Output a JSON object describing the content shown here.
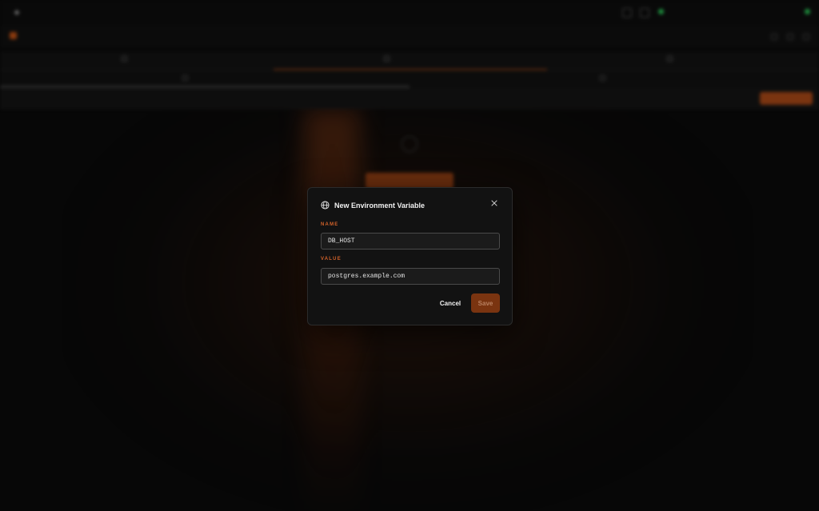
{
  "modal": {
    "title": "New Environment Variable",
    "name_label": "NAME",
    "name_value": "DB_HOST",
    "value_label": "VALUE",
    "value_value": "postgres.example.com",
    "cancel_label": "Cancel",
    "save_label": "Save",
    "title_icon": "globe-icon",
    "close_icon": "close-icon"
  },
  "colors": {
    "accent": "#d2622a",
    "save_button": "#7a3410",
    "modal_background": "#121212",
    "status_green": "#1e8f3e"
  }
}
